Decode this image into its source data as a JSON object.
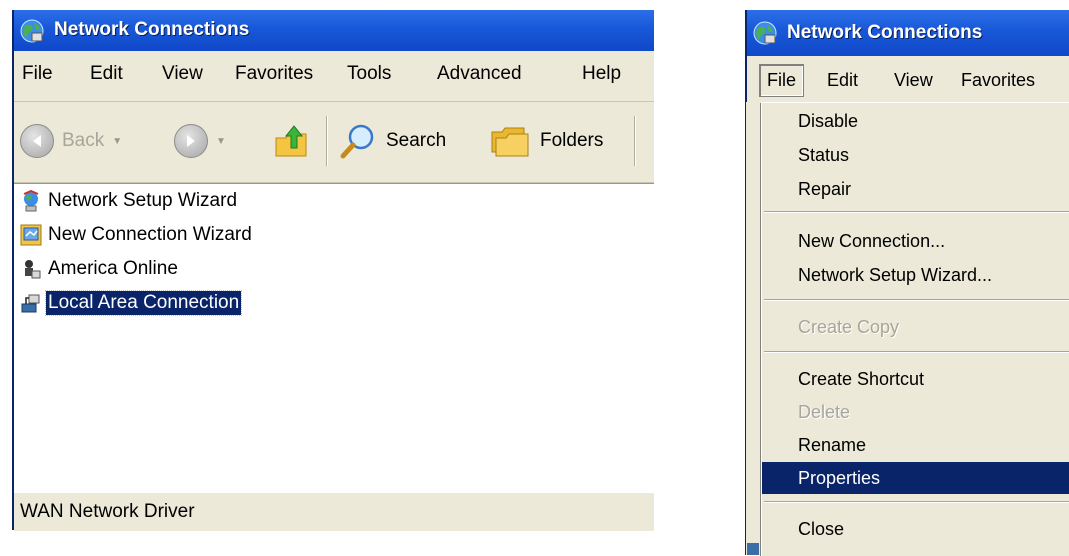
{
  "left_window": {
    "title": "Network Connections",
    "menu": [
      "File",
      "Edit",
      "View",
      "Favorites",
      "Tools",
      "Advanced",
      "Help"
    ],
    "toolbar": {
      "back_label": "Back",
      "search_label": "Search",
      "folders_label": "Folders"
    },
    "items": [
      {
        "label": "Network Setup Wizard",
        "icon": "network-setup-wizard-icon"
      },
      {
        "label": "New Connection Wizard",
        "icon": "new-connection-wizard-icon"
      },
      {
        "label": "America Online",
        "icon": "dialup-connection-icon"
      },
      {
        "label": "Local Area Connection",
        "icon": "lan-connection-icon",
        "selected": true
      }
    ],
    "status": "WAN Network Driver"
  },
  "right_window": {
    "title": "Network Connections",
    "menu": [
      "File",
      "Edit",
      "View",
      "Favorites"
    ],
    "open_menu": "File",
    "file_menu": [
      {
        "label": "Disable",
        "enabled": true
      },
      {
        "label": "Status",
        "enabled": true
      },
      {
        "label": "Repair",
        "enabled": true
      },
      {
        "label": "New Connection...",
        "enabled": true
      },
      {
        "label": "Network Setup Wizard...",
        "enabled": true
      },
      {
        "label": "Create Copy",
        "enabled": false
      },
      {
        "label": "Create Shortcut",
        "enabled": true
      },
      {
        "label": "Delete",
        "enabled": false
      },
      {
        "label": "Rename",
        "enabled": true
      },
      {
        "label": "Properties",
        "enabled": true,
        "highlighted": true
      },
      {
        "label": "Close",
        "enabled": true
      }
    ]
  },
  "colors": {
    "titlebar": "#1858d8",
    "selection": "#0a246a",
    "window_face": "#ece9d8"
  }
}
